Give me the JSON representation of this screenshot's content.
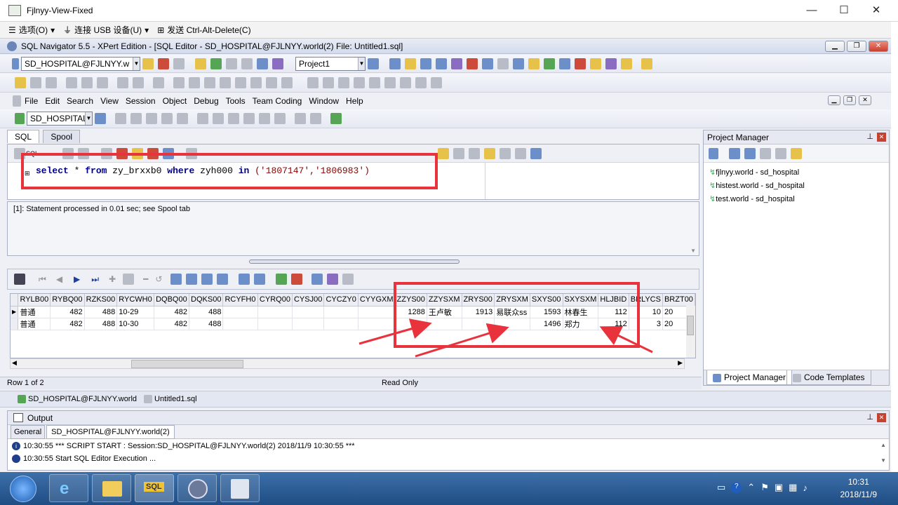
{
  "vm_window": {
    "title": "Fjlnyy-View-Fixed",
    "minimize": "—",
    "maximize": "☐",
    "close": "✕"
  },
  "vm_menu": [
    "选项(O)",
    "连接 USB 设备(U)",
    "发送 Ctrl-Alt-Delete(C)"
  ],
  "app_title": "SQL Navigator 5.5 - XPert Edition - [SQL Editor - SD_HOSPITAL@FJLNYY.world(2) File: Untitled1.sql]",
  "toolbar1": {
    "connection": "SD_HOSPITAL@FJLNYY.w",
    "project": "Project1"
  },
  "menu": [
    "File",
    "Edit",
    "Search",
    "View",
    "Session",
    "Object",
    "Debug",
    "Tools",
    "Team Coding",
    "Window",
    "Help"
  ],
  "session_combo": "SD_HOSPITAL",
  "sql_tabs": [
    "SQL",
    "Spool"
  ],
  "sql_toolbar_label": "SQL",
  "sql": {
    "kw_select": "select",
    "star": " * ",
    "kw_from": "from",
    "table": " zy_brxxb0 ",
    "kw_where": "where",
    "col": " zyh000 ",
    "kw_in": "in",
    "vals": " ('1807147','1806983')"
  },
  "message": "[1]: Statement processed in 0.01 sec; see Spool tab",
  "grid": {
    "columns": [
      "RYLB00",
      "RYBQ00",
      "RZKS00",
      "RYCWH0",
      "DQBQ00",
      "DQKS00",
      "RCYFH0",
      "CYRQ00",
      "CYSJ00",
      "CYCZY0",
      "CYYGXM",
      "ZZYS00",
      "ZZYSXM",
      "ZRYS00",
      "ZRYSXM",
      "SXYS00",
      "SXYSXM",
      "HLJBID",
      "BRLYCS",
      "BRZT00"
    ],
    "rows": [
      [
        "普通",
        "482",
        "488",
        "10-29",
        "482",
        "488",
        "",
        "",
        "",
        "",
        "",
        "1288",
        "王卢敏",
        "1913",
        "易联众ss",
        "1593",
        "林春生",
        "112",
        "10",
        "20"
      ],
      [
        "普通",
        "482",
        "488",
        "10-30",
        "482",
        "488",
        "",
        "",
        "",
        "",
        "",
        "",
        "",
        "",
        "",
        "1496",
        "郑力",
        "112",
        "3",
        "20"
      ]
    ]
  },
  "status": {
    "row": "Row 1 of 2",
    "mode": "Read Only"
  },
  "doc_tabs": [
    "SD_HOSPITAL@FJLNYY.world",
    "Untitled1.sql"
  ],
  "project_manager": {
    "title": "Project Manager",
    "items": [
      "fjlnyy.world - sd_hospital",
      "histest.world - sd_hospital",
      "test.world - sd_hospital"
    ],
    "tabs": [
      "Project Manager",
      "Code Templates"
    ]
  },
  "output": {
    "title": "Output",
    "tabs": [
      "General",
      "SD_HOSPITAL@FJLNYY.world(2)"
    ],
    "lines": [
      "10:30:55  *** SCRIPT START :  Session:SD_HOSPITAL@FJLNYY.world(2)   2018/11/9 10:30:55 ***",
      "10:30:55  Start SQL Editor Execution ..."
    ]
  },
  "taskbar": {
    "time": "10:31",
    "date": "2018/11/9",
    "sql_label": "SQL"
  },
  "annotation_color": "#e8333c"
}
